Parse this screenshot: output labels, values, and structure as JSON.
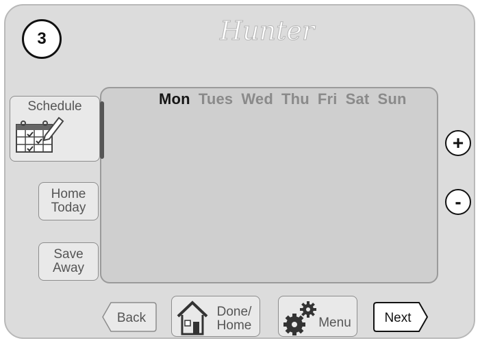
{
  "step": {
    "number": "3"
  },
  "brand": {
    "name": "Hunter"
  },
  "screen": {
    "days": [
      "Mon",
      "Tues",
      "Wed",
      "Thu",
      "Fri",
      "Sat",
      "Sun"
    ],
    "active_day": "Mon"
  },
  "buttons": {
    "schedule": "Schedule",
    "home_today": [
      "Home",
      "Today"
    ],
    "save_away": [
      "Save",
      "Away"
    ],
    "plus": "+",
    "minus": "-",
    "back": "Back",
    "done_home": [
      "Done/",
      "Home"
    ],
    "menu": "Menu",
    "next": "Next"
  },
  "icons": {
    "schedule": "calendar-pencil-icon",
    "done_home": "house-icon",
    "menu": "gears-icon"
  }
}
